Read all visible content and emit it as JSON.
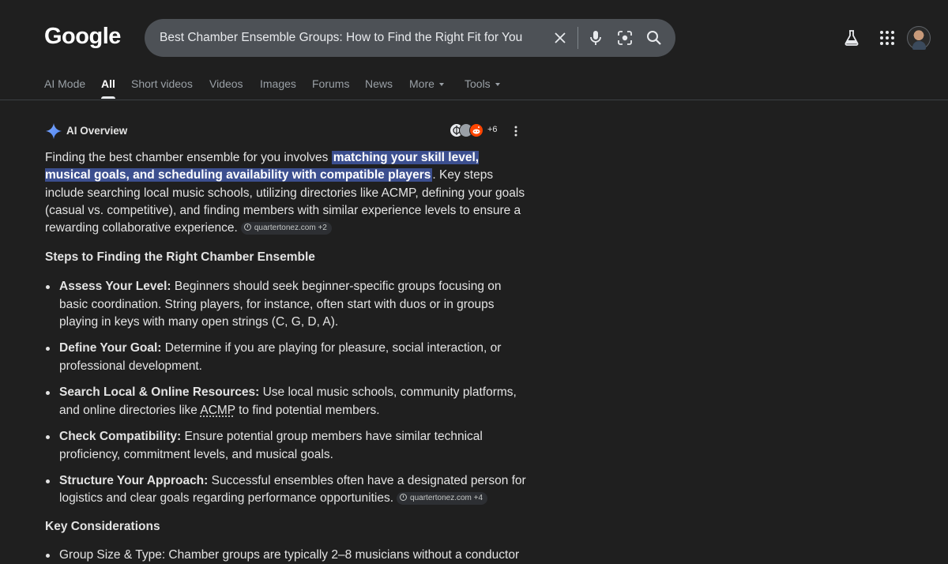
{
  "logo": "Google",
  "search": {
    "query": "Best Chamber Ensemble Groups: How to Find the Right Fit for You"
  },
  "tabs": [
    {
      "label": "AI Mode"
    },
    {
      "label": "All"
    },
    {
      "label": "Short videos"
    },
    {
      "label": "Videos"
    },
    {
      "label": "Images"
    },
    {
      "label": "Forums"
    },
    {
      "label": "News"
    },
    {
      "label": "More"
    },
    {
      "label": "Tools"
    }
  ],
  "ai_overview": {
    "title": "AI Overview",
    "sources_more": "+6",
    "intro_before": "Finding the best chamber ensemble for you involves ",
    "intro_highlight": "matching your skill level, musical goals, and scheduling availability with compatible players",
    "intro_after": ". Key steps include searching local music schools, utilizing directories like ACMP, defining your goals (casual vs. competitive), and finding members with similar experience levels to ensure a rewarding collaborative experience.",
    "intro_citation": "quartertonez.com +2",
    "steps_heading": "Steps to Finding the Right Chamber Ensemble",
    "steps": [
      {
        "title": "Assess Your Level:",
        "text": " Beginners should seek beginner-specific groups focusing on basic coordination. String players, for instance, often start with duos or in groups playing in keys with many open strings (C, G, D, A)."
      },
      {
        "title": "Define Your Goal:",
        "text": " Determine if you are playing for pleasure, social interaction, or professional development."
      },
      {
        "title": "Search Local & Online Resources:",
        "text_before": " Use local music schools, community platforms, and online directories like ",
        "link": "ACMP",
        "text_after": " to find potential members."
      },
      {
        "title": "Check Compatibility:",
        "text": " Ensure potential group members have similar technical proficiency, commitment levels, and musical goals."
      },
      {
        "title": "Structure Your Approach:",
        "text": " Successful ensembles often have a designated person for logistics and clear goals regarding performance opportunities.",
        "citation": "quartertonez.com +4"
      }
    ],
    "considerations_heading": "Key Considerations",
    "considerations_partial": "Group Size & Type: Chamber groups are typically 2–8 musicians without a conductor"
  }
}
